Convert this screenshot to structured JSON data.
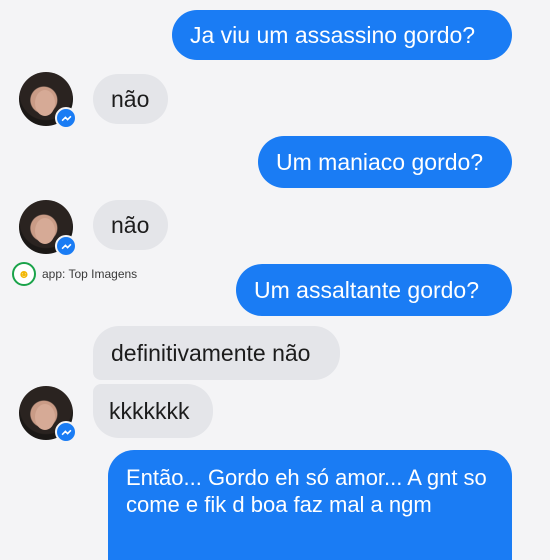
{
  "colors": {
    "outgoing_bubble": "#1a7cf4",
    "incoming_bubble": "#e4e5e9",
    "background": "#f4f4f6",
    "badge": "#1a7cf4"
  },
  "messages": [
    {
      "sender": "me",
      "text": "Ja viu um assassino gordo?"
    },
    {
      "sender": "them",
      "text": "não"
    },
    {
      "sender": "me",
      "text": "Um maniaco gordo?"
    },
    {
      "sender": "them",
      "text": "não"
    },
    {
      "sender": "me",
      "text": "Um assaltante gordo?"
    },
    {
      "sender": "them",
      "text": "definitivamente não"
    },
    {
      "sender": "them",
      "text": "kkkkkkk"
    },
    {
      "sender": "me",
      "text": "Então... Gordo eh só amor... A gnt so come e fik d boa faz mal a ngm"
    }
  ],
  "avatar_icon": "contact-avatar",
  "badge_icon": "messenger-bolt-icon",
  "watermark": {
    "label": "app: Top Imagens",
    "icon": "smiley-logo-icon"
  }
}
